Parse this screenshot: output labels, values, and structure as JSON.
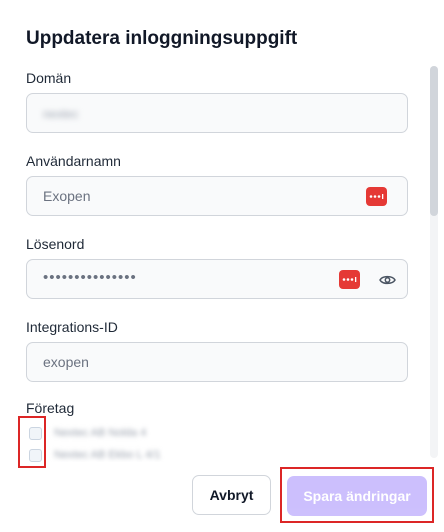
{
  "dialog": {
    "title": "Uppdatera inloggningsuppgift"
  },
  "fields": {
    "domain": {
      "label": "Domän",
      "value": "nextec"
    },
    "username": {
      "label": "Användarnamn",
      "value": "Exopen"
    },
    "password": {
      "label": "Lösenord",
      "value": "•••••••••••••••"
    },
    "integration_id": {
      "label": "Integrations-ID",
      "value": "exopen"
    }
  },
  "companies": {
    "label": "Företag",
    "items": [
      {
        "name": "Nextec AB Nolda 4"
      },
      {
        "name": "Nextec AB Ekbo L 4/1"
      }
    ]
  },
  "buttons": {
    "cancel": "Avbryt",
    "save": "Spara ändringar"
  },
  "icons": {
    "password_manager": "password-manager-icon",
    "show_password": "eye-icon"
  },
  "colors": {
    "accent_disabled": "#c4b5fd",
    "password_manager": "#e53935",
    "highlight": "#dc2626"
  }
}
